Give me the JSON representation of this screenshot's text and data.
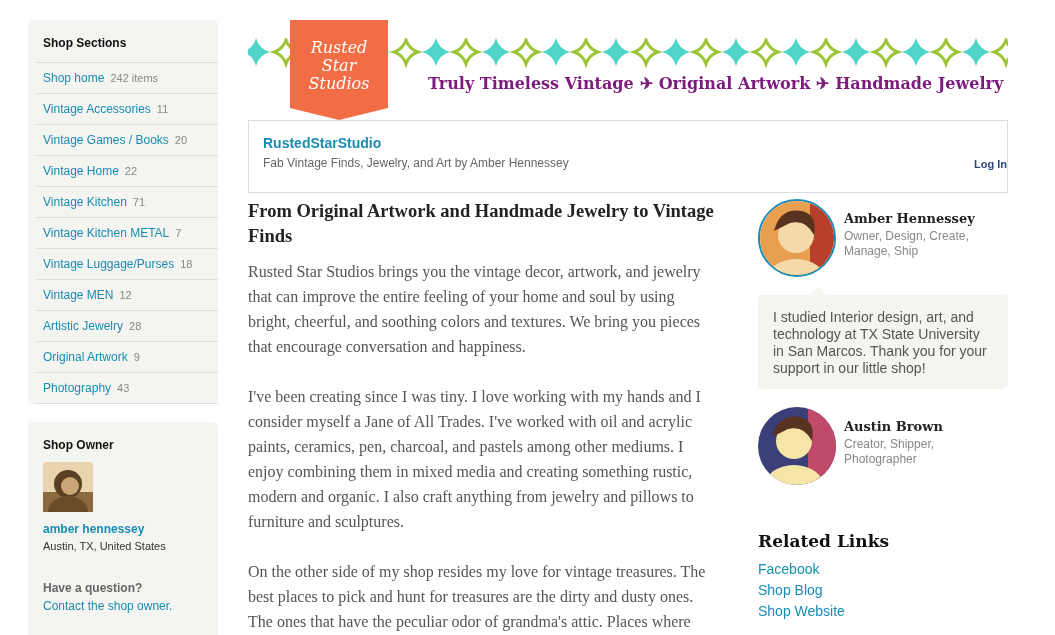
{
  "sidebar": {
    "sections_title": "Shop Sections",
    "sections": [
      {
        "label": "Shop home",
        "count": "242 items"
      },
      {
        "label": "Vintage Accessories",
        "count": "11"
      },
      {
        "label": "Vintage Games / Books",
        "count": "20"
      },
      {
        "label": "Vintage Home",
        "count": "22"
      },
      {
        "label": "Vintage Kitchen",
        "count": "71"
      },
      {
        "label": "Vintage Kitchen METAL",
        "count": "7"
      },
      {
        "label": "Vintage Luggage/Purses",
        "count": "18"
      },
      {
        "label": "Vintage MEN",
        "count": "12"
      },
      {
        "label": "Artistic Jewelry",
        "count": "28"
      },
      {
        "label": "Original Artwork",
        "count": "9"
      },
      {
        "label": "Photography",
        "count": "43"
      }
    ],
    "owner": {
      "title": "Shop Owner",
      "name": "amber hennessey",
      "location": "Austin, TX, United States",
      "question": "Have a question?",
      "contact": "Contact the shop owner."
    }
  },
  "banner": {
    "logo_lines": [
      "Rusted",
      "Star",
      "Studios"
    ],
    "tagline_parts": [
      "Truly Timeless Vintage",
      "✈",
      "Original Artwork",
      "✈",
      "Handmade Jewelry"
    ]
  },
  "shop_header": {
    "name": "RustedStarStudio",
    "subtitle": "Fab Vintage Finds, Jewelry, and Art by Amber Hennessey",
    "login": "Log In"
  },
  "about": {
    "title": "From Original Artwork and Handmade Jewelry to Vintage Finds",
    "paragraphs": [
      "Rusted Star Studios brings you the vintage decor, artwork, and jewelry that can improve the entire feeling of your home and soul by using bright, cheerful, and soothing colors and textures. We bring you pieces that encourage conversation and happiness.",
      "I've been creating since I was tiny. I love working with my hands and I consider myself a Jane of All Trades. I've worked with oil and acrylic paints, ceramics, pen, charcoal, and pastels among other mediums. I enjoy combining them in mixed media and creating something rustic, modern and organic. I also craft anything from jewelry and pillows to furniture and sculptures.",
      "On the other side of my shop resides my love for vintage treasures. The best places to pick and hunt for treasures are the dirty and dusty ones. The ones that have the peculiar odor of grandma's attic. Places where"
    ]
  },
  "members": [
    {
      "name": "Amber Hennessey",
      "roles": "Owner, Design, Create, Manage, Ship",
      "bio": "I studied Interior design, art, and technology at TX State University in San Marcos. Thank you for your support in our little shop!",
      "selected": true
    },
    {
      "name": "Austin Brown",
      "roles": "Creator, Shipper, Photographer",
      "selected": false
    }
  ],
  "related_links": {
    "title": "Related Links",
    "links": [
      "Facebook",
      "Shop Blog",
      "Shop Website"
    ]
  }
}
